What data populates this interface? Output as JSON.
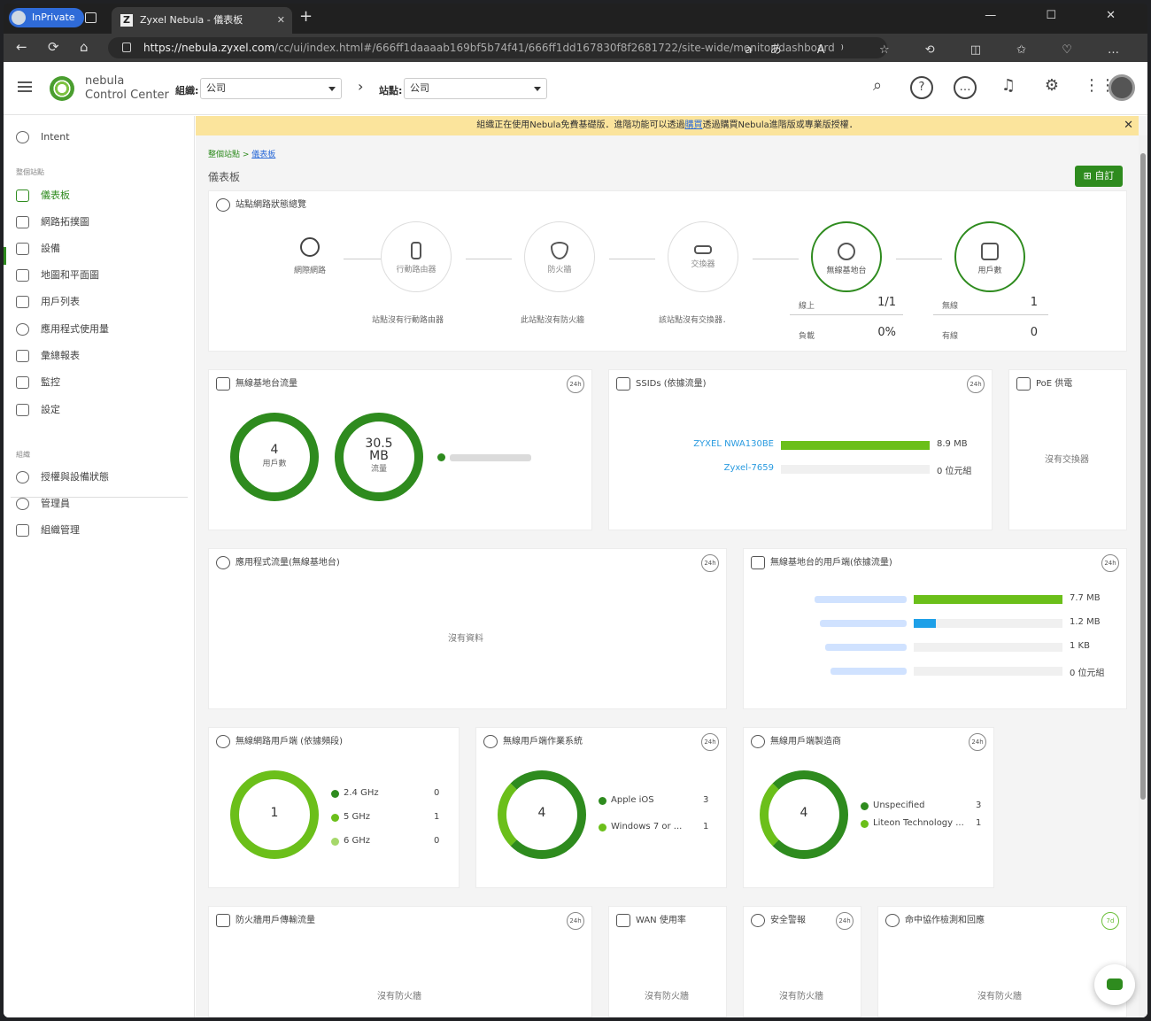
{
  "browser": {
    "inprivate": "InPrivate",
    "tab_title": "Zyxel Nebula - 儀表板",
    "tab_close": "✕",
    "new_tab": "+",
    "window_controls": "—  ☐  ✕",
    "url_host": "https://nebula.zyxel.com",
    "url_path": "/cc/ui/index.html#/666ff1daaaab169bf5b74f41/666ff1dd167830f8f2681722/site-wide/monitor/dashboard",
    "tools": "ａあ A⁾ ☆ ⟲ ◫ ✩ ♡ …"
  },
  "header": {
    "brand_line1": "nebula",
    "brand_line2": "Control Center",
    "org_label": "組織:",
    "org_value": "公司",
    "site_label": "站點:",
    "site_value": "公司",
    "chevron": "›"
  },
  "sidebar": {
    "intent": "Intent",
    "group_site": "整個站點",
    "items": [
      "儀表板",
      "網路拓撲圖",
      "設備",
      "地圖和平面圖",
      "用戶列表",
      "應用程式使用量",
      "彙總報表",
      "監控",
      "設定"
    ],
    "group_org": "組織",
    "org_items": [
      "授權與設備狀態",
      "管理員",
      "組織管理"
    ]
  },
  "banner": {
    "text1": "組織正在使用Nebula免費基礎版．進階功能可以透過",
    "link": "購買",
    "text2": "透過購買Nebula進階版或專業版授權．",
    "close": "✕"
  },
  "breadcrumb": {
    "parent": "整個站點 > ",
    "current": "儀表板"
  },
  "page_title": "儀表板",
  "customize": "⊞ 自訂",
  "topology": {
    "title": "站點網路狀態總覽",
    "internet": "網際網路",
    "router": "行動路由器",
    "firewall": "防火牆",
    "switch": "交換器",
    "ap": "無線基地台",
    "clients": "用戶數",
    "router_note": "站點沒有行動路由器",
    "firewall_note": "此站點沒有防火牆",
    "switch_note": "該站點沒有交換器．",
    "ap_online_label": "線上",
    "ap_online_value": "1/1",
    "ap_load_label": "負載",
    "ap_load_value": "0%",
    "wireless_label": "無線",
    "wireless_value": "1",
    "wired_label": "有線",
    "wired_value": "0"
  },
  "ap_traffic": {
    "title": "無線基地台流量",
    "badge": "24h",
    "clients_value": "4",
    "clients_label": "用戶數",
    "traffic_value": "30.5",
    "traffic_unit": "MB",
    "traffic_label": "流量"
  },
  "ssids": {
    "title": "SSIDs (依據流量)",
    "badge": "24h",
    "rows": [
      {
        "name": "ZYXEL NWA130BE",
        "value": "8.9 MB",
        "pct": 100
      },
      {
        "name": "Zyxel-7659",
        "value": "0 位元組",
        "pct": 0
      }
    ]
  },
  "poe": {
    "title": "PoE 供電",
    "nodata": "沒有交換器"
  },
  "app_traffic": {
    "title": "應用程式流量(無線基地台)",
    "badge": "24h",
    "nodata": "沒有資料"
  },
  "ap_clients": {
    "title": "無線基地台的用戶端(依據流量)",
    "badge": "24h",
    "rows": [
      {
        "value": "7.7 MB",
        "pct": 100,
        "color": "#6bbf1a"
      },
      {
        "value": "1.2 MB",
        "pct": 15,
        "color": "#1ea0e8"
      },
      {
        "value": "1 KB",
        "pct": 0,
        "color": "#6bbf1a"
      },
      {
        "value": "0 位元組",
        "pct": 0,
        "color": "#6bbf1a"
      }
    ]
  },
  "band": {
    "title": "無線網路用戶端 (依據頻段)",
    "badge": "24h",
    "total": "1",
    "rows": [
      {
        "label": "2.4 GHz",
        "value": "0",
        "color": "#2e8b1e"
      },
      {
        "label": "5 GHz",
        "value": "1",
        "color": "#6bbf1a"
      },
      {
        "label": "6 GHz",
        "value": "0",
        "color": "#a6d86a"
      }
    ]
  },
  "os": {
    "title": "無線用戶端作業系統",
    "badge": "24h",
    "total": "4",
    "rows": [
      {
        "label": "Apple iOS",
        "value": "3",
        "color": "#2e8b1e"
      },
      {
        "label": "Windows 7 or ...",
        "value": "1",
        "color": "#6bbf1a"
      }
    ]
  },
  "vendor": {
    "title": "無線用戶端製造商",
    "badge": "24h",
    "total": "4",
    "rows": [
      {
        "label": "Unspecified",
        "value": "3",
        "color": "#2e8b1e"
      },
      {
        "label": "Liteon Technology ...",
        "value": "1",
        "color": "#6bbf1a"
      }
    ]
  },
  "fw_traffic": {
    "title": "防火牆用戶傳輸流量",
    "badge": "24h",
    "nodata": "沒有防火牆"
  },
  "wan": {
    "title": "WAN 使用率",
    "nodata": "沒有防火牆"
  },
  "security": {
    "title": "安全警報",
    "badge": "24h",
    "nodata": "沒有防火牆"
  },
  "collab": {
    "title": "命中協作檢測和回應",
    "badge": "7d",
    "nodata": "沒有防火牆"
  },
  "colors": {
    "green": "#2e8b1e",
    "light_green": "#6bbf1a",
    "blue": "#1ea0e8",
    "banner": "#fbe49c"
  }
}
